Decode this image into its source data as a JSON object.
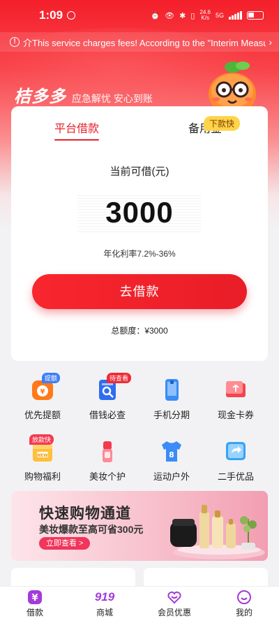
{
  "status_bar": {
    "time": "1:09",
    "net_speed_top": "24.6",
    "net_speed_bottom": "K/s",
    "network": "5G"
  },
  "notice": {
    "text": "介This service charges fees! According to the \"Interim Measures for the Administration of Internet Loans of Commercial Banks\" and other laws"
  },
  "brand": {
    "logo": "桔多多",
    "slogan": "应急解忧 安心到账"
  },
  "loan_card": {
    "tabs": [
      {
        "label": "平台借款",
        "active": true
      },
      {
        "label": "备用金",
        "active": false
      }
    ],
    "tab_badge": "下款快",
    "available_label": "当前可借(元)",
    "amount": "3000",
    "rate": "年化利率7.2%-36%",
    "borrow_button": "去借款",
    "total_quota": "总额度：¥3000"
  },
  "services": [
    {
      "label": "优先提额",
      "icon": "money-bag-icon",
      "badge": "提额",
      "badge_color": "#3f7ef5"
    },
    {
      "label": "借钱必查",
      "icon": "search-doc-icon",
      "badge": "待查看",
      "badge_color": "#ef2b36"
    },
    {
      "label": "手机分期",
      "icon": "phone-icon",
      "badge": "",
      "badge_color": ""
    },
    {
      "label": "现金卡券",
      "icon": "gift-card-icon",
      "badge": "",
      "badge_color": ""
    },
    {
      "label": "购物福利",
      "icon": "shopping-new-icon",
      "badge": "放款快",
      "badge_color": "#f33b52"
    },
    {
      "label": "美妆个护",
      "icon": "lipstick-icon",
      "badge": "",
      "badge_color": ""
    },
    {
      "label": "运动户外",
      "icon": "jersey-icon",
      "badge": "",
      "badge_color": ""
    },
    {
      "label": "二手优品",
      "icon": "refresh-arrow-icon",
      "badge": "",
      "badge_color": ""
    }
  ],
  "banner": {
    "title": "快速购物通道",
    "subtitle": "美妆爆款至高可省300元",
    "button": "立即查看 >"
  },
  "bottom_nav": [
    {
      "label": "借款",
      "icon": "yen-icon",
      "active": true
    },
    {
      "label": "商城",
      "icon": "919-mall-icon",
      "logo_text": "919",
      "active": false
    },
    {
      "label": "会员优惠",
      "icon": "heart-gift-icon",
      "active": false
    },
    {
      "label": "我的",
      "icon": "smile-icon",
      "active": false
    }
  ],
  "colors": {
    "brand_red": "#e3222b",
    "badge_yellow": "#ffd44a",
    "nav_purple": "#a23bd9"
  }
}
